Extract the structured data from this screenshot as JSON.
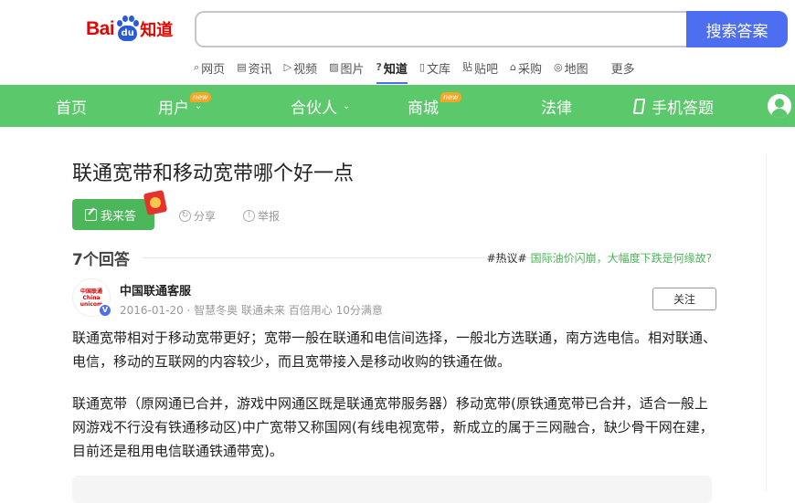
{
  "logo": {
    "bai": "Bai",
    "du": "du",
    "zhidao": "知道"
  },
  "search": {
    "value": "",
    "placeholder": "",
    "button_label": "搜索答案"
  },
  "channels": [
    {
      "icon": "⌕",
      "label": "网页"
    },
    {
      "icon": "▤",
      "label": "资讯"
    },
    {
      "icon": "▷",
      "label": "视频"
    },
    {
      "icon": "▨",
      "label": "图片"
    },
    {
      "icon": "?",
      "label": "知道"
    },
    {
      "icon": "▯",
      "label": "文库"
    },
    {
      "icon": "贴",
      "label": "贴吧"
    },
    {
      "icon": "⌂",
      "label": "采购"
    },
    {
      "icon": "◎",
      "label": "地图"
    },
    {
      "label": "更多"
    }
  ],
  "nav": {
    "home": "首页",
    "user": "用户",
    "partner": "合伙人",
    "mall": "商城",
    "law": "法律",
    "mobile": "手机答题",
    "new_badge": "new",
    "chevron": "⌄"
  },
  "question": {
    "title": "联通宽带和移动宽带哪个好一点"
  },
  "actions": {
    "answer": "我来答",
    "share": "分享",
    "report": "举报"
  },
  "answers_count": "7个回答",
  "hot": {
    "tag": "#热议#",
    "link": "国际油价闪崩，大幅度下跌是何缘故?"
  },
  "answer": {
    "user_name": "中国联通客服",
    "avatar_text": "中国联通 China unicom",
    "verified": "V",
    "meta": "2016-01-20 · 智慧冬奥 联通未来 百倍用心 10分满意",
    "follow": "关注",
    "paragraph1": "联通宽带相对于移动宽带更好；宽带一般在联通和电信间选择，一般北方选联通，南方选电信。相对联通、电信，移动的互联网的内容较少，而且宽带接入是移动收购的铁通在做。",
    "paragraph2": "联通宽带（原网通已合并，游戏中网通区既是联通宽带服务器）移动宽带(原铁通宽带已合并，适合一般上网游戏不行没有铁通移动区)中广宽带又称国网(有线电视宽带，新成立的属于三网融合，缺少骨干网在建，目前还是租用电信联通铁通带宽)。"
  },
  "colors": {
    "nav_green": "#5bc86c",
    "button_green": "#4cb65a",
    "search_blue": "#4e6ef2",
    "baidu_red": "#e10601"
  }
}
